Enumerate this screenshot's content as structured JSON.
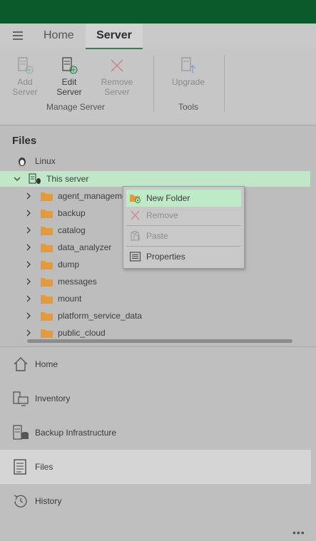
{
  "tabs": {
    "home": "Home",
    "server": "Server"
  },
  "ribbon": {
    "add_server": [
      "Add",
      "Server"
    ],
    "edit_server": [
      "Edit",
      "Server"
    ],
    "remove_server": [
      "Remove",
      "Server"
    ],
    "upgrade": "Upgrade",
    "group_manage": "Manage Server",
    "group_tools": "Tools"
  },
  "files": {
    "title": "Files",
    "linux": "Linux",
    "this_server": "This server",
    "folders": [
      "agent_management",
      "backup",
      "catalog",
      "data_analyzer",
      "dump",
      "messages",
      "mount",
      "platform_service_data",
      "public_cloud"
    ]
  },
  "context_menu": {
    "new_folder": "New Folder",
    "remove": "Remove",
    "paste": "Paste",
    "properties": "Properties"
  },
  "nav": {
    "home": "Home",
    "inventory": "Inventory",
    "backup_infrastructure": "Backup Infrastructure",
    "files": "Files",
    "history": "History",
    "more": "•••"
  },
  "colors": {
    "titlebar": "#0b5a2c",
    "selected": "#bfe7c8",
    "folder": "#e39a3a",
    "accent": "#3a7a50"
  }
}
